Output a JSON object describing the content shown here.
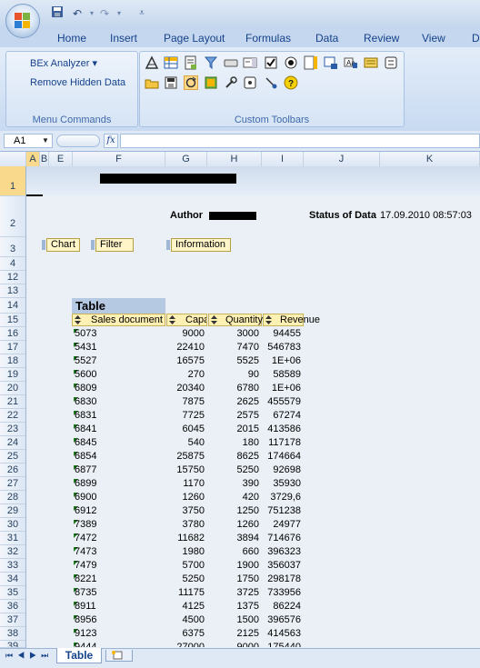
{
  "quick_access": {
    "save_icon": "save-icon",
    "undo_icon": "undo-icon",
    "redo_icon": "redo-icon",
    "customize_icon": "qat-customize-icon"
  },
  "ribbon_tabs": [
    "Home",
    "Insert",
    "Page Layout",
    "Formulas",
    "Data",
    "Review",
    "View",
    "D"
  ],
  "ribbon": {
    "menu_commands": {
      "bex_analyzer": "BEx Analyzer ▾",
      "remove_hidden": "Remove Hidden Data",
      "group_label": "Menu Commands"
    },
    "custom_toolbars": {
      "group_label": "Custom Toolbars"
    }
  },
  "formula_bar": {
    "cell_ref": "A1",
    "fx_label": "fx",
    "value": ""
  },
  "columns": [
    "A",
    "B",
    "E",
    "F",
    "G",
    "H",
    "I",
    "J",
    "K"
  ],
  "rows": [
    "1",
    "2",
    "3",
    "4",
    "12",
    "13",
    "14",
    "15",
    "16",
    "17",
    "18",
    "19",
    "20",
    "21",
    "22",
    "23",
    "24",
    "25",
    "26",
    "27",
    "28",
    "29",
    "30",
    "31",
    "32",
    "33",
    "34",
    "35",
    "36",
    "37",
    "38",
    "39"
  ],
  "header": {
    "author_label": "Author",
    "status_label": "Status of Data",
    "status_value": "17.09.2010 08:57:03"
  },
  "buttons": {
    "chart": "Chart",
    "filter": "Filter",
    "information": "Information"
  },
  "table": {
    "title": "Table",
    "columns": [
      "Sales document",
      "Capa",
      "Quantity",
      "Revenue"
    ],
    "rows": [
      [
        "5073",
        "9000",
        "3000",
        "94455"
      ],
      [
        "5431",
        "22410",
        "7470",
        "546783"
      ],
      [
        "5527",
        "16575",
        "5525",
        "1E+06"
      ],
      [
        "5600",
        "270",
        "90",
        "58589"
      ],
      [
        "6809",
        "20340",
        "6780",
        "1E+06"
      ],
      [
        "6830",
        "7875",
        "2625",
        "455579"
      ],
      [
        "6831",
        "7725",
        "2575",
        "67274"
      ],
      [
        "6841",
        "6045",
        "2015",
        "413586"
      ],
      [
        "6845",
        "540",
        "180",
        "117178"
      ],
      [
        "6854",
        "25875",
        "8625",
        "174664"
      ],
      [
        "6877",
        "15750",
        "5250",
        "92698"
      ],
      [
        "6899",
        "1170",
        "390",
        "35930"
      ],
      [
        "6900",
        "1260",
        "420",
        "3729,6"
      ],
      [
        "6912",
        "3750",
        "1250",
        "751238"
      ],
      [
        "7389",
        "3780",
        "1260",
        "24977"
      ],
      [
        "7472",
        "11682",
        "3894",
        "714676"
      ],
      [
        "7473",
        "1980",
        "660",
        "396323"
      ],
      [
        "7479",
        "5700",
        "1900",
        "356037"
      ],
      [
        "8221",
        "5250",
        "1750",
        "298178"
      ],
      [
        "8735",
        "11175",
        "3725",
        "733956"
      ],
      [
        "8911",
        "4125",
        "1375",
        "86224"
      ],
      [
        "8956",
        "4500",
        "1500",
        "396576"
      ],
      [
        "9123",
        "6375",
        "2125",
        "414563"
      ],
      [
        "9444",
        "27000",
        "9000",
        "175440"
      ]
    ]
  },
  "sheet_tabs": {
    "active": "Table"
  },
  "colors": {
    "accent": "#15428b",
    "ribbon": "#c5d7ee",
    "table_header": "#fff0b4",
    "sheet_bg": "#eaf0f6"
  }
}
